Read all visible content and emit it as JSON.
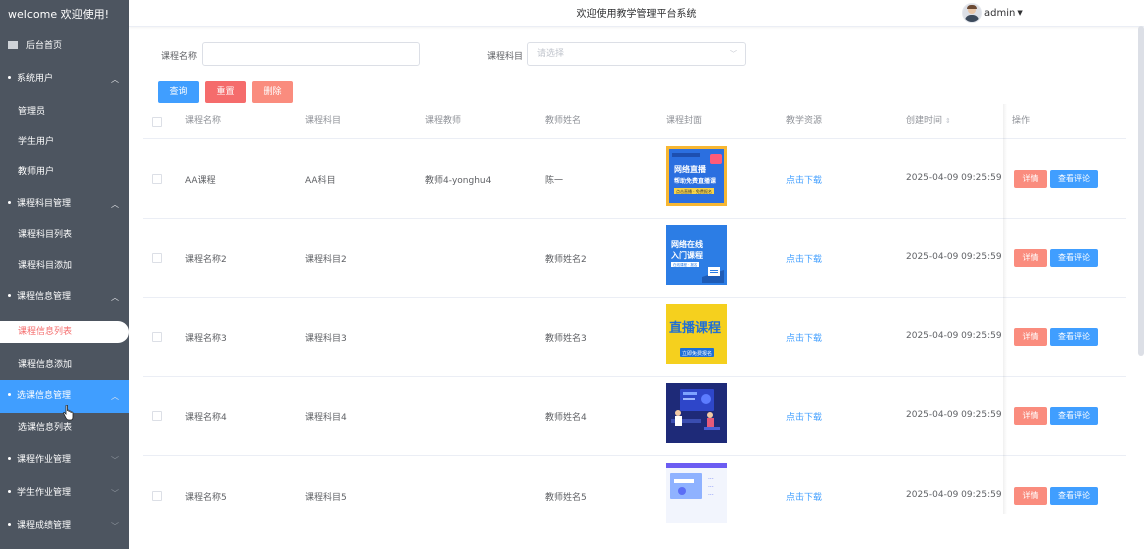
{
  "sidebar": {
    "welcome": "welcome 欢迎使用!",
    "home": "后台首页",
    "items": [
      {
        "label": "系统用户",
        "type": "group"
      },
      {
        "label": "管理员",
        "type": "sub"
      },
      {
        "label": "学生用户",
        "type": "sub"
      },
      {
        "label": "教师用户",
        "type": "sub"
      },
      {
        "label": "课程科目管理",
        "type": "group"
      },
      {
        "label": "课程科目列表",
        "type": "sub"
      },
      {
        "label": "课程科目添加",
        "type": "sub"
      },
      {
        "label": "课程信息管理",
        "type": "group"
      },
      {
        "label": "课程信息列表",
        "type": "active"
      },
      {
        "label": "课程信息添加",
        "type": "sub"
      },
      {
        "label": "选课信息管理",
        "type": "highlight"
      },
      {
        "label": "选课信息列表",
        "type": "sub"
      },
      {
        "label": "课程作业管理",
        "type": "group"
      },
      {
        "label": "学生作业管理",
        "type": "group"
      },
      {
        "label": "课程成绩管理",
        "type": "group"
      }
    ]
  },
  "header": {
    "title": "欢迎使用教学管理平台系统",
    "user": "admin"
  },
  "search": {
    "name_label": "课程名称",
    "name_value": "",
    "subject_label": "课程科目",
    "subject_placeholder": "请选择",
    "query_button": "查询",
    "reset_button": "重置",
    "delete_button": "删除"
  },
  "table": {
    "columns": [
      "课程名称",
      "课程科目",
      "课程教师",
      "教师姓名",
      "课程封面",
      "教学资源",
      "创建时间",
      "操作"
    ],
    "rows": [
      {
        "name": "AA课程",
        "subject": "AA科目",
        "teacher": "教师4-yonghu4",
        "teacher_name": "陈一",
        "cover": "cover1",
        "resource": "点击下载",
        "created": "2025-04-09 09:25:59"
      },
      {
        "name": "课程名称2",
        "subject": "课程科目2",
        "teacher": "",
        "teacher_name": "教师姓名2",
        "cover": "cover2",
        "resource": "点击下载",
        "created": "2025-04-09 09:25:59"
      },
      {
        "name": "课程名称3",
        "subject": "课程科目3",
        "teacher": "",
        "teacher_name": "教师姓名3",
        "cover": "cover3",
        "resource": "点击下载",
        "created": "2025-04-09 09:25:59"
      },
      {
        "name": "课程名称4",
        "subject": "课程科目4",
        "teacher": "",
        "teacher_name": "教师姓名4",
        "cover": "cover4",
        "resource": "点击下载",
        "created": "2025-04-09 09:25:59"
      },
      {
        "name": "课程名称5",
        "subject": "课程科目5",
        "teacher": "",
        "teacher_name": "教师姓名5",
        "cover": "cover5",
        "resource": "点击下载",
        "created": "2025-04-09 09:25:59"
      }
    ],
    "detail_button": "详情",
    "review_button": "查看评论"
  },
  "covers": {
    "cover1": {
      "line1": "网络直播",
      "line2": "帮助免费直播课",
      "line3": "点击直播 · 免费报名"
    },
    "cover2": {
      "line1": "网络在线",
      "line2": "入门课程",
      "line3": "在线课程 · 报名"
    },
    "cover3": {
      "line1": "直播课程",
      "line2": "立即免费报名"
    }
  },
  "colors": {
    "sidebar_bg": "#4d5560",
    "primary": "#409eff",
    "danger": "#f56c6c",
    "detail": "#fa8c7e"
  }
}
